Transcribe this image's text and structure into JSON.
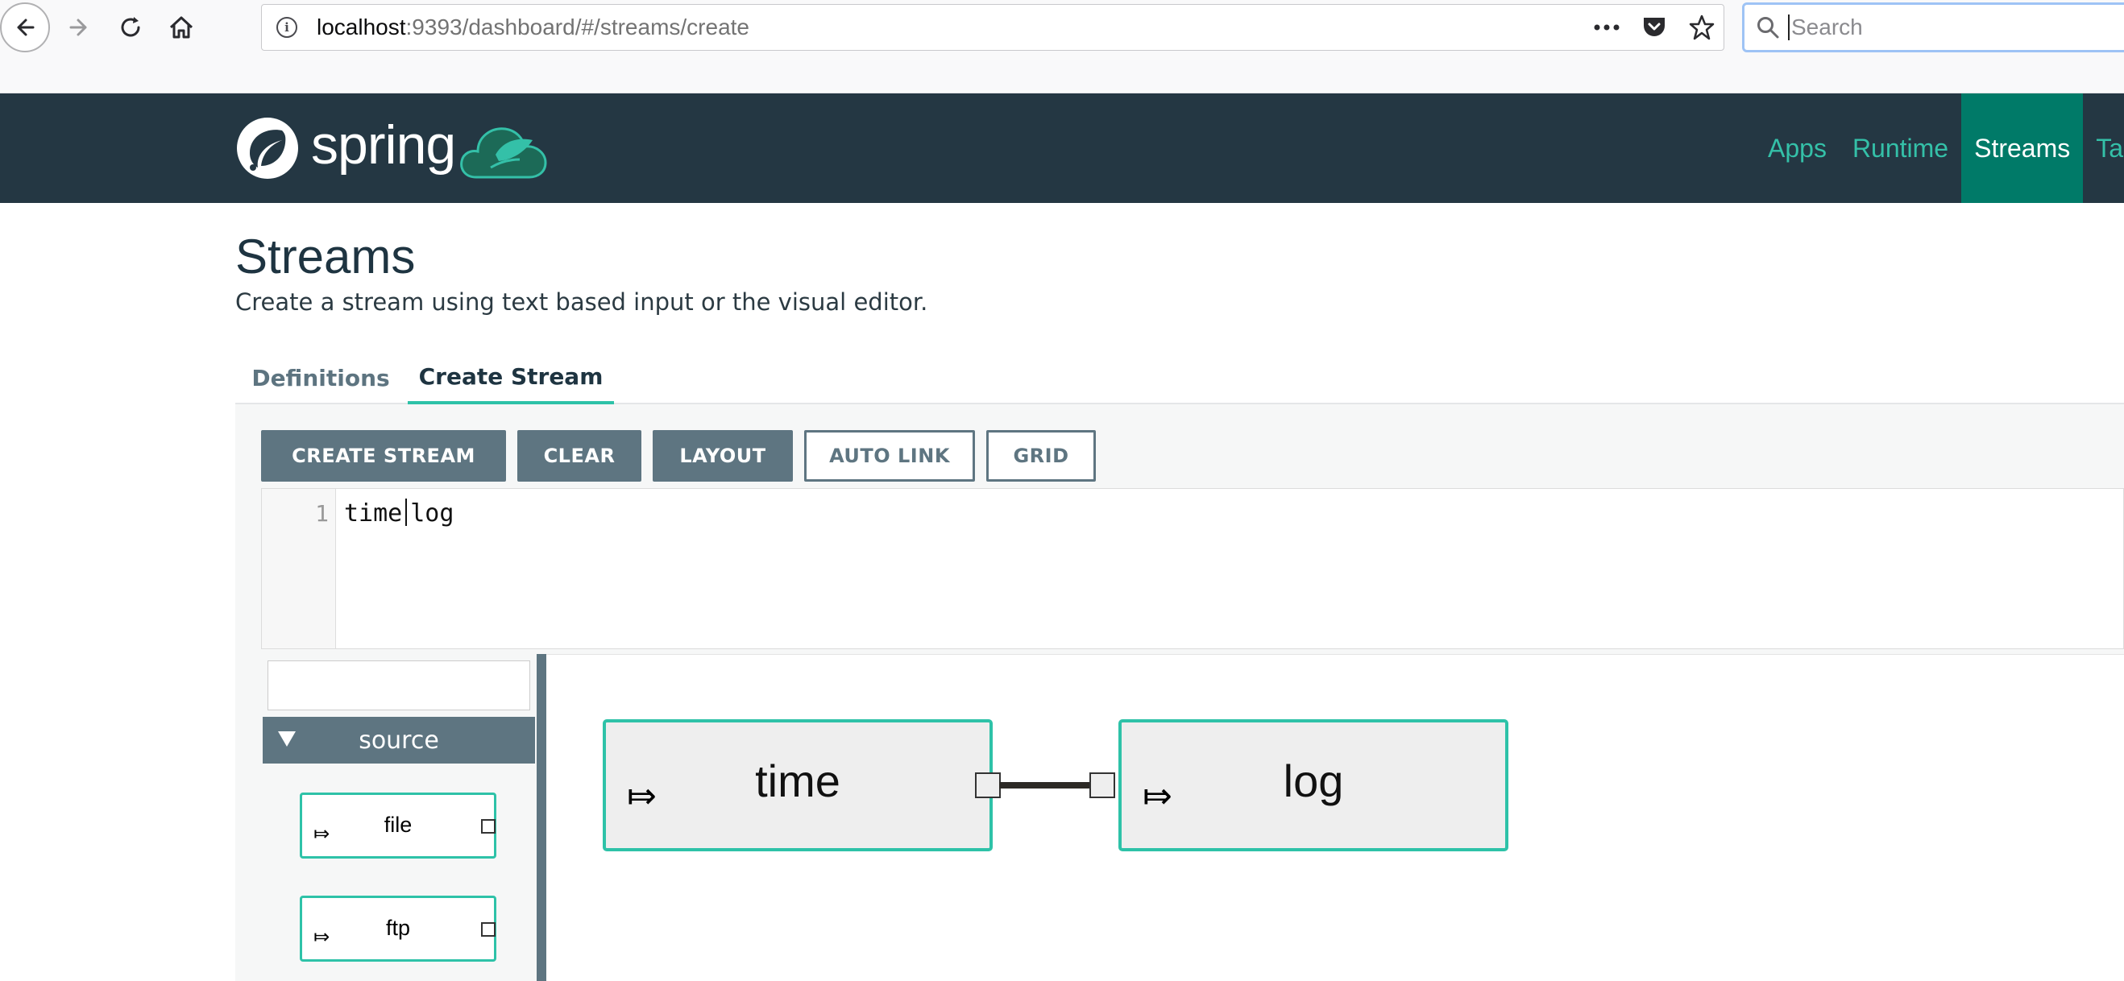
{
  "browser": {
    "url_host": "localhost",
    "url_rest": ":9393/dashboard/#/streams/create",
    "search_placeholder": "Search"
  },
  "app": {
    "logo_text": "spring",
    "nav": [
      "Apps",
      "Runtime",
      "Streams",
      "Ta"
    ],
    "active_nav": "Streams"
  },
  "page": {
    "title": "Streams",
    "subtitle": "Create a stream using text based input or the visual editor.",
    "tabs": [
      "Definitions",
      "Create Stream"
    ],
    "active_tab": "Create Stream"
  },
  "toolbar": {
    "create_stream": "CREATE STREAM",
    "clear": "CLEAR",
    "layout": "LAYOUT",
    "auto_link": "AUTO LINK",
    "grid": "GRID"
  },
  "editor": {
    "line_number": "1",
    "code_left": "time",
    "code_right": "log"
  },
  "palette": {
    "filter_value": "",
    "group": "source",
    "items": [
      "file",
      "ftp"
    ]
  },
  "canvas": {
    "nodes": [
      "time",
      "log"
    ]
  },
  "colors": {
    "header_bg": "#243743",
    "accent": "#2ec2a8",
    "active_nav_bg": "#007a68",
    "button": "#5e7581"
  }
}
